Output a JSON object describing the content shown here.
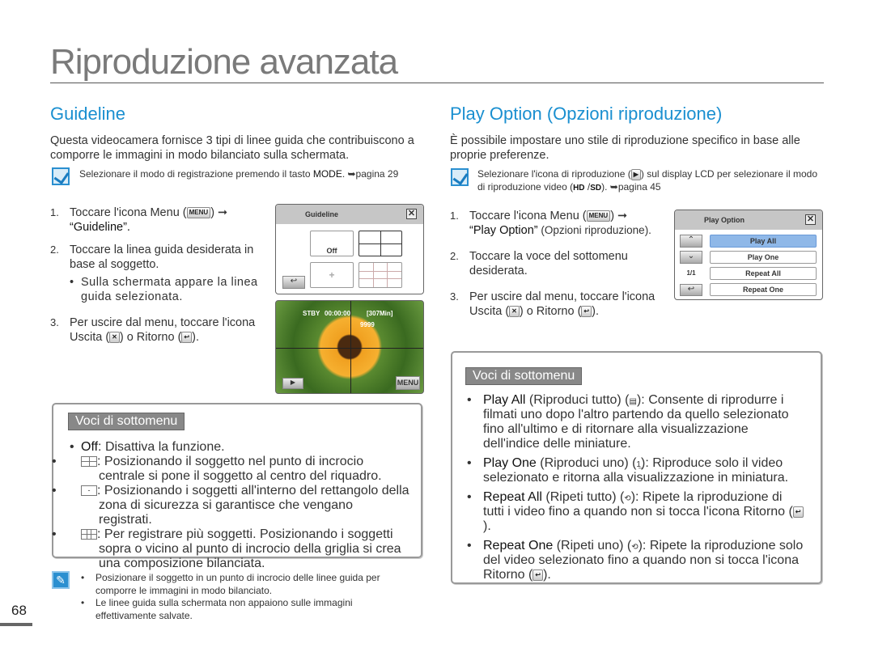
{
  "title": "Riproduzione avanzata",
  "page_number": "68",
  "left": {
    "heading": "Guideline",
    "intro": "Questa videocamera fornisce 3 tipi di linee guida che contribuiscono a comporre le immagini in modo bilanciato sulla schermata.",
    "note_a": "Selezionare il modo di registrazione premendo il tasto ",
    "note_mode": "MODE",
    "note_b": ". ➥pagina 29",
    "steps": [
      {
        "n": "1.",
        "a": "Toccare l'icona Menu (",
        "icon": "MENU",
        "b": ") ➞",
        "c": "“Guideline”."
      },
      {
        "n": "2.",
        "a": "Toccare la linea guida desiderata in base al soggetto.",
        "sub": "Sulla schermata appare la linea guida selezionata."
      },
      {
        "n": "3.",
        "a": "Per uscire dal menu, toccare l'icona Uscita (",
        "b": ") o Ritorno (",
        "c": ")."
      }
    ],
    "lcd1": {
      "title": "Guideline",
      "off": "Off"
    },
    "lcd2": {
      "status": "STBY",
      "time": "00:00:00",
      "remain": "[307Min]",
      "count": "9999",
      "menu": "MENU"
    },
    "submenu": {
      "label": "Voci di sottomenu",
      "items": [
        {
          "term": "Off",
          "text": ": Disattiva la funzione."
        },
        {
          "text": ": Posizionando il soggetto nel punto di incrocio centrale si pone il soggetto al centro del riquadro."
        },
        {
          "text": ": Posizionando i soggetti all'interno del rettangolo della zona di sicurezza si garantisce che vengano registrati."
        },
        {
          "text": ": Per registrare più soggetti. Posizionando i soggetti sopra o vicino al punto di incrocio della griglia si crea una composizione bilanciata."
        }
      ]
    },
    "notes": [
      "Posizionare il soggetto in un punto di incrocio delle linee guida per comporre le immagini in modo bilanciato.",
      "Le linee guida sulla schermata non appaiono sulle immagini effettivamente salvate."
    ]
  },
  "right": {
    "heading": "Play Option (Opzioni riproduzione)",
    "intro": "È possibile impostare uno stile di riproduzione specifico in base alle proprie preferenze.",
    "note_a": "Selezionare l'icona di riproduzione (",
    "note_b": ") sul display LCD per selezionare il modo di riproduzione video (",
    "hd": "HD",
    "sd": "SD",
    "note_c": "). ➥pagina 45",
    "steps": [
      {
        "n": "1.",
        "a": "Toccare l'icona Menu (",
        "icon": "MENU",
        "b": ") ➞",
        "term": "“Play Option”",
        "c": " (Opzioni riproduzione)."
      },
      {
        "n": "2.",
        "a": "Toccare la voce del sottomenu desiderata."
      },
      {
        "n": "3.",
        "a": "Per uscire dal menu, toccare l'icona Uscita (",
        "b": ") o Ritorno (",
        "c": ")."
      }
    ],
    "lcd": {
      "title": "Play Option",
      "page": "1/1",
      "options": [
        "Play All",
        "Play One",
        "Repeat All",
        "Repeat One"
      ]
    },
    "submenu": {
      "label": "Voci di sottomenu",
      "items": [
        {
          "term": "Play All",
          "paren": " (Riproduci tutto) (",
          "text": "): Consente di riprodurre i filmati uno dopo l'altro partendo da quello selezionato fino all'ultimo e di ritornare alla visualizzazione dell'indice delle miniature."
        },
        {
          "term": "Play One",
          "paren": " (Riproduci uno) (",
          "text": "): Riproduce solo il video selezionato e ritorna alla visualizzazione in miniatura."
        },
        {
          "term": "Repeat All",
          "paren": " (Ripeti tutto) (",
          "text": "): Ripete la riproduzione di tutti i video fino a quando non si tocca l'icona Ritorno (",
          "end": ")."
        },
        {
          "term": "Repeat One",
          "paren": " (Ripeti uno) (",
          "text": "): Ripete la riproduzione solo del video selezionato fino a quando non si tocca l'icona Ritorno (",
          "end": ")."
        }
      ]
    }
  },
  "colors": {
    "accent": "#1a8fd0",
    "highlight": "#8fb8e8"
  }
}
